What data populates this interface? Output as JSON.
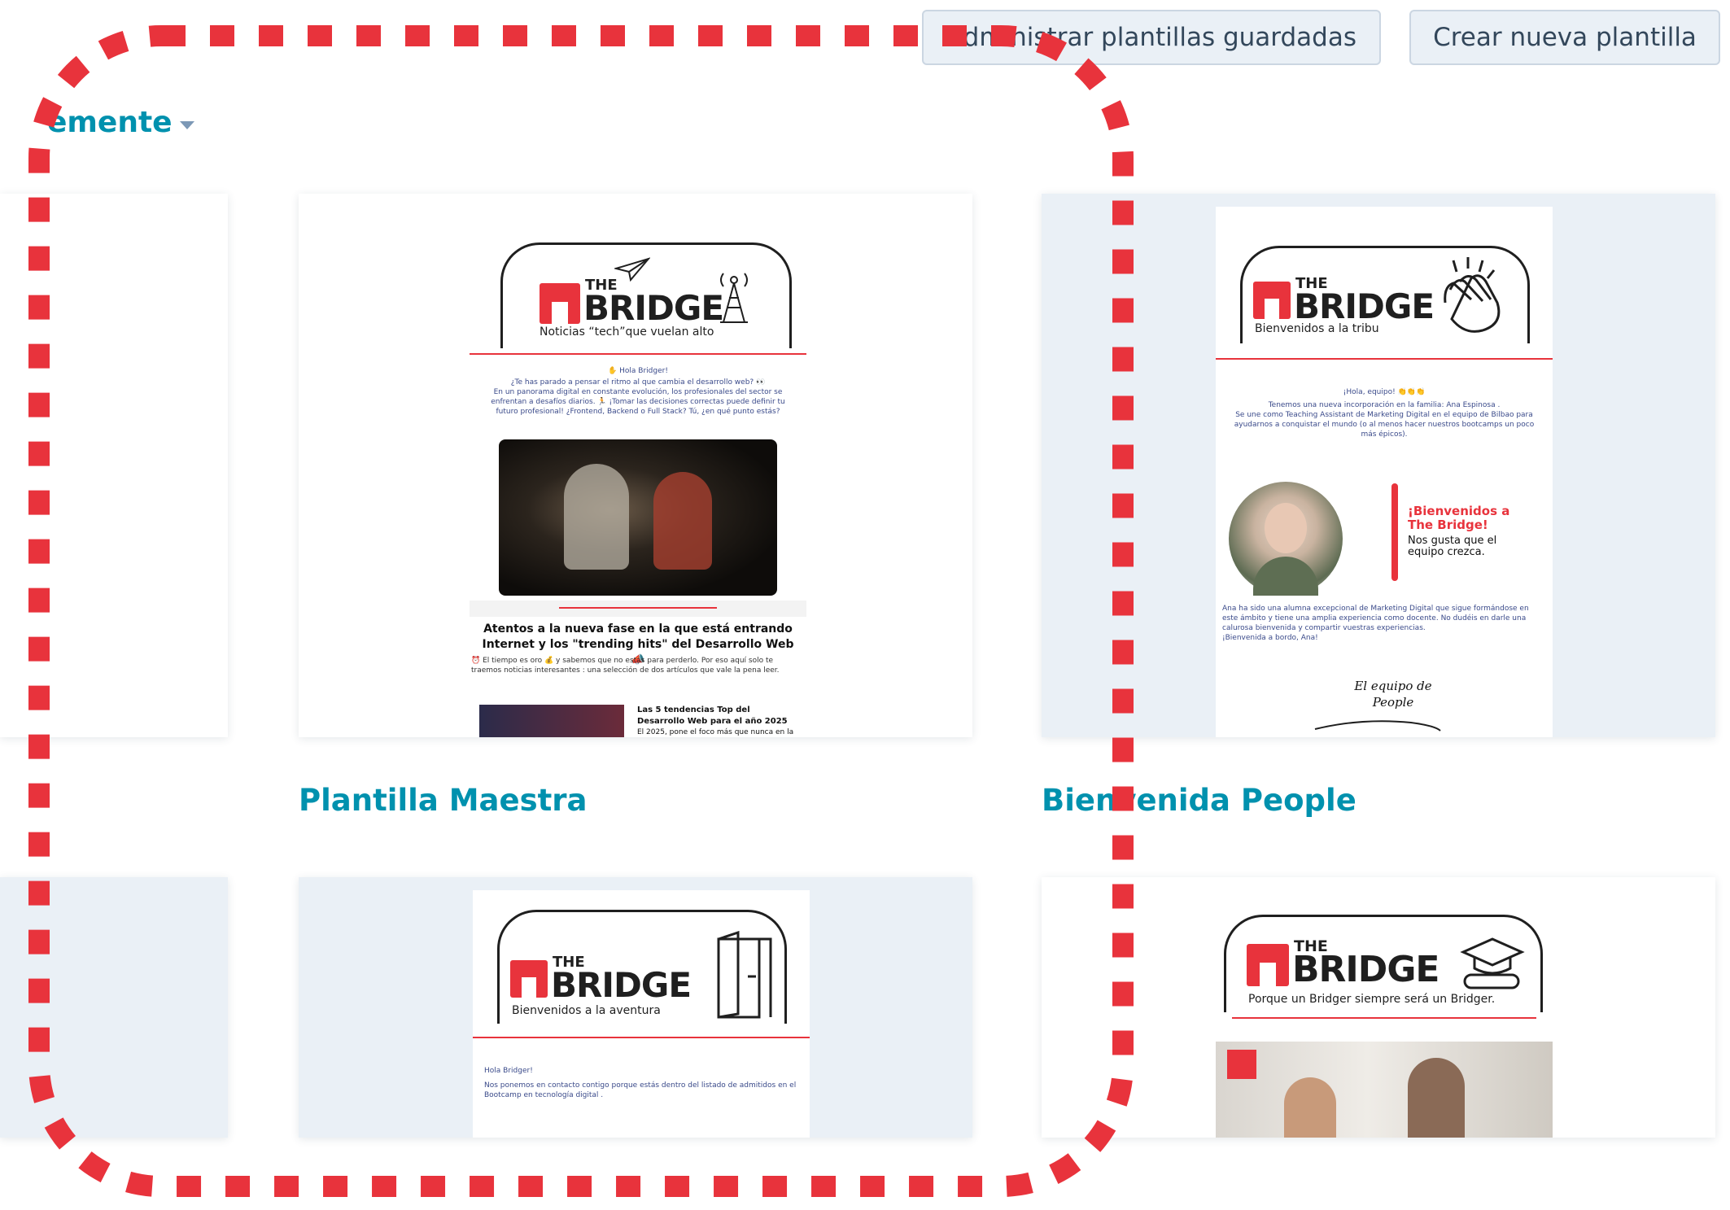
{
  "toolbar": {
    "manage_label": "Administrar plantillas guardadas",
    "create_label": "Crear nueva plantilla"
  },
  "sort": {
    "label": "emente"
  },
  "templates": [
    {
      "title": "Plantilla Maestra",
      "preview": {
        "logo_the": "THE",
        "logo_bridge": "BRIDGE",
        "tagline": "Noticias “tech”que vuelan alto",
        "greeting": "✋ Hola Bridger!",
        "intro": "¿Te has parado a pensar el ritmo al que cambia el desarrollo web? 👀\nEn un panorama digital en constante evolución, los profesionales del sector se enfrentan a desafíos diarios. 🏃 ¡Tomar las decisiones correctas puede definir tu futuro profesional! ¿Frontend, Backend o Full Stack? Tú, ¿en qué punto estás?",
        "headline": "Atentos a la nueva fase en la que está entrando Internet y los \"trending hits\" del Desarrollo Web 📣",
        "subtext": "⏰ El tiempo es oro 💰 y sabemos que no estás para perderlo. Por eso aquí solo te traemos noticias interesantes : una selección de dos artículos que vale la pena leer.",
        "article_title": "Las 5 tendencias Top del Desarrollo Web para el año 2025",
        "article_snippet": "El 2025, pone el foco más que nunca en la"
      }
    },
    {
      "title": "Bienvenida People",
      "preview": {
        "logo_the": "THE",
        "logo_bridge": "BRIDGE",
        "tagline": "Bienvenidos a la tribu",
        "greeting": "¡Hola, equipo! 👏👏👏",
        "intro": "Tenemos una nueva incorporación en la familia: Ana Espinosa .\nSe une como Teaching Assistant de Marketing Digital en el equipo de Bilbao para ayudarnos a conquistar el mundo (o al menos hacer nuestros bootcamps un poco más épicos).",
        "badge_title": "¡Bienvenidos a The Bridge!",
        "badge_text": "Nos gusta que el equipo crezca.",
        "body": "Ana ha sido una alumna excepcional de Marketing Digital que sigue formándose en este ámbito y tiene una amplia experiencia como docente. No dudéis en darle una calurosa bienvenida y compartir vuestras experiencias.\n¡Bienvenida a bordo, Ana!",
        "signature": "El equipo de People"
      }
    },
    {
      "title": "",
      "preview": {
        "logo_the": "THE",
        "logo_bridge": "BRIDGE",
        "tagline": "Bienvenidos a la aventura",
        "greeting": "Hola Bridger!",
        "intro": "Nos ponemos en contacto contigo porque estás dentro del listado de admitidos en el Bootcamp en tecnología digital ."
      }
    },
    {
      "title": "",
      "preview": {
        "logo_the": "THE",
        "logo_bridge": "BRIDGE",
        "tagline": "Porque un Bridger siempre será un Bridger."
      }
    }
  ],
  "colors": {
    "accent": "#0091ae",
    "brand_red": "#e8333c",
    "dotted_frame": "#e8333c"
  }
}
